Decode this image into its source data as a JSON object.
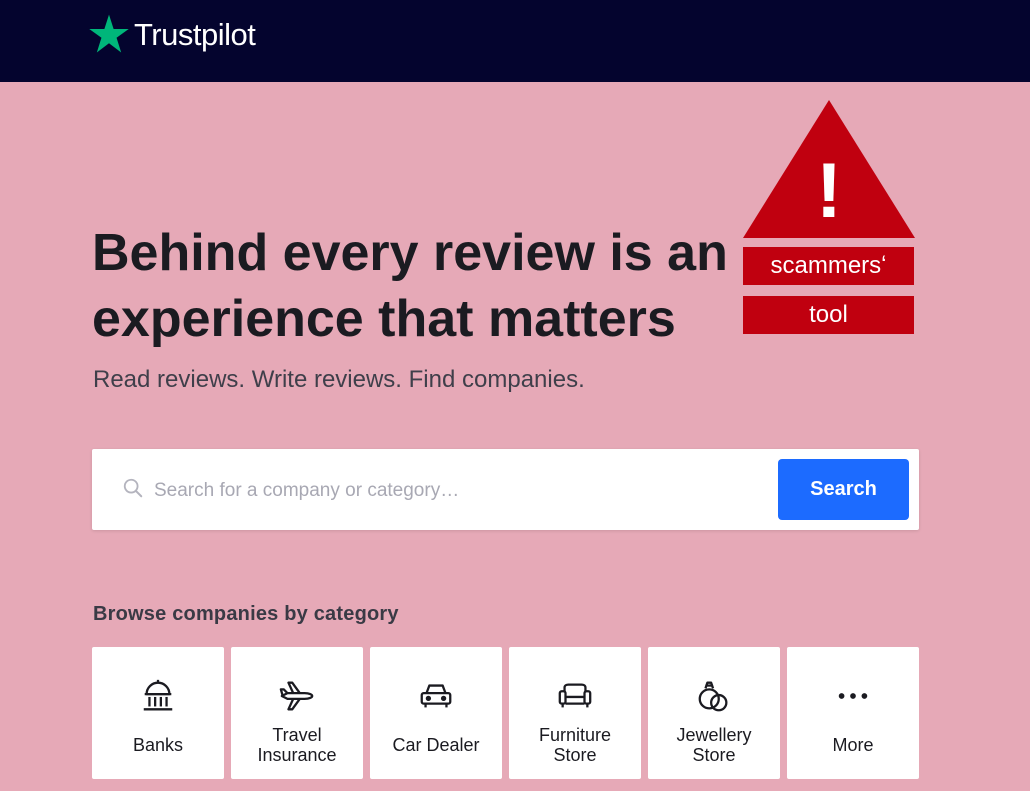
{
  "header": {
    "brand": "Trustpilot",
    "background": "#04042e",
    "star_color": "#00b67a"
  },
  "hero": {
    "title": "Behind every review is an experience that matters",
    "subtitle": "Read reviews. Write reviews. Find companies."
  },
  "warning": {
    "symbol": "!",
    "line1": "scammersʻ",
    "line2": "tool",
    "color": "#c0000f"
  },
  "search": {
    "placeholder": "Search for a company or category…",
    "value": "",
    "button_label": "Search",
    "button_color": "#1c6bff"
  },
  "browse": {
    "title": "Browse companies by category",
    "categories": [
      {
        "label": "Banks",
        "icon": "bank-icon"
      },
      {
        "label": "Travel Insurance",
        "icon": "airplane-icon"
      },
      {
        "label": "Car Dealer",
        "icon": "car-icon"
      },
      {
        "label": "Furniture Store",
        "icon": "armchair-icon"
      },
      {
        "label": "Jewellery Store",
        "icon": "rings-icon"
      },
      {
        "label": "More",
        "icon": "more-dots-icon"
      }
    ]
  },
  "colors": {
    "page_background": "#e6a9b7"
  }
}
